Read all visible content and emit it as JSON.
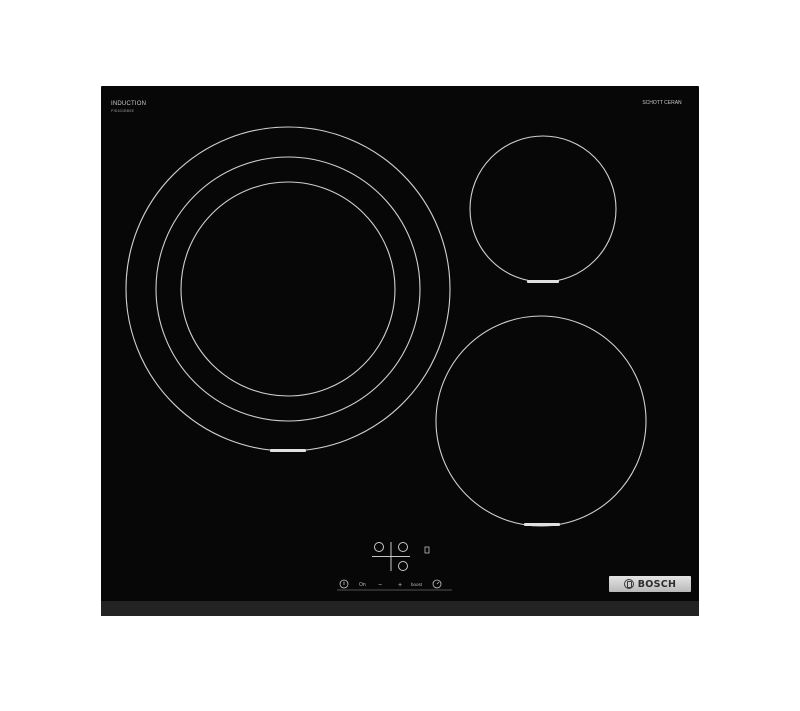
{
  "product": {
    "type_label": "INDUCTION",
    "type_sublabel": "PID631BB5E",
    "glass_brand": "SCHOTT CERAN",
    "brand": "BOSCH"
  },
  "controls": {
    "on_label": "On",
    "minus_label": "−",
    "plus_label": "+",
    "boost_label": "boost",
    "power_symbol": "⏻",
    "timer_symbol": "⏱"
  },
  "colors": {
    "glass": "#070707",
    "zone_line": "#d0d0d0",
    "brand_plate": "#d4d4d4"
  }
}
